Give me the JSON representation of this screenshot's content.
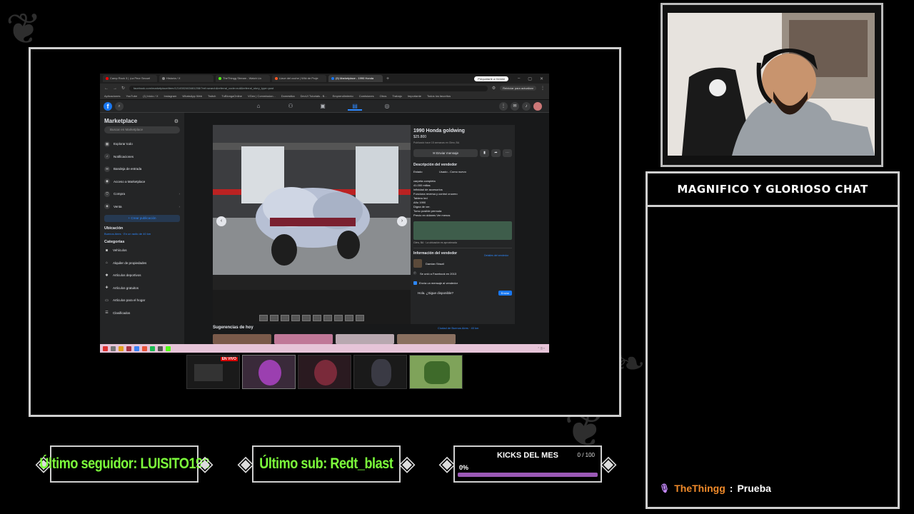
{
  "browser": {
    "tabs": [
      {
        "label": "Camp Rock 3 | ¡La Peor Secuel",
        "color": "#ff0000"
      },
      {
        "label": "Historia / X",
        "color": "#888888"
      },
      {
        "label": "TheThingg Stream - Watch Liv",
        "color": "#53fc18"
      },
      {
        "label": "Llave del coche | Wiki de Proje",
        "color": "#ff5722"
      },
      {
        "label": "(5) Marketplace - 1990 Honda",
        "color": "#1877f2"
      }
    ],
    "gemini_button": "Preguntarle a Gemini",
    "url": "facebook.com/marketplace/item/1214502463461208/?ref=search&referral_code=null&referral_story_type=post",
    "update_button": "Reiniciar para actualizar",
    "bookmarks": [
      "Aplicaciones",
      "YouTube",
      "(1) Inicio / X",
      "Instagram",
      "WhatsApp Web",
      "Twitch",
      "TuBlongaOnline",
      "VGen | Commission...",
      "Domestika",
      "DevUI Tutorials - B...",
      "Emprendimiento",
      "Comisiones",
      "Otros",
      "Trabajo",
      "Importante",
      "Todos los favoritos"
    ]
  },
  "marketplace": {
    "title": "Marketplace",
    "search_placeholder": "Buscar en Marketplace",
    "nav": [
      "Explorar todo",
      "Notificaciones",
      "Bandeja de entrada",
      "Acceso a Marketplace",
      "Compra",
      "Venta"
    ],
    "create_button": "+ Crear publicación",
    "location_heading": "Ubicación",
    "location_text": "Buenos Aires · En un radio de 40 km",
    "categories_heading": "Categorías",
    "categories": [
      "Vehículos",
      "Alquiler de propiedades",
      "Artículos deportivos",
      "Artículos gratuitos",
      "Artículos para el hogar",
      "Clasificados"
    ]
  },
  "listing": {
    "title": "1990 Honda goldwing",
    "price": "$25.800",
    "posted": "Publicado hace 15 semanas en Glew, BA",
    "message_button": "Enviar mensaje",
    "description_heading": "Descripción del vendedor",
    "state_label": "Estado",
    "state_value": "Usado - Como nuevo",
    "description_lines": [
      "carpeta completa",
      "41.000 millas",
      "infinidad de accesorios",
      "Funciona reversa y control crucero",
      "Tablero led",
      "Año 1990",
      "Digna de ver.",
      "Tomo posible permuta",
      "Precio en dólares Ver menos"
    ],
    "location": "Glew, BA · La ubicación es aproximada",
    "seller_heading": "Información del vendedor",
    "seller_details_link": "Detalles del vendedor",
    "seller_name": "Damian Strazil",
    "seller_joined": "Se unió a Facebook en 2013",
    "send_msg_label": "Envía un mensaje al vendedor",
    "msg_text": "Hola. ¿Sigue disponible?",
    "send_button": "Enviar",
    "suggestions_heading": "Sugerencias de hoy",
    "suggestions_location": "Ciudad de Buenos Aires · 40 km"
  },
  "scenes": {
    "live_badge": "EN VIVO"
  },
  "chat": {
    "title": "MAGNIFICO Y GLORIOSO CHAT",
    "message_user": "TheThingg",
    "message_sep": ":",
    "message_text": "Prueba",
    "user_color": "#f08a2a"
  },
  "widgets": {
    "last_follower": "Último seguidor: LUISITO193",
    "last_sub": "Último sub: Redt_blast",
    "kicks_title": "KICKS DEL MES",
    "kicks_count": "0 / 100",
    "kicks_percent": "0%",
    "kicks_progress": 0,
    "text_color": "#7cff3b"
  }
}
